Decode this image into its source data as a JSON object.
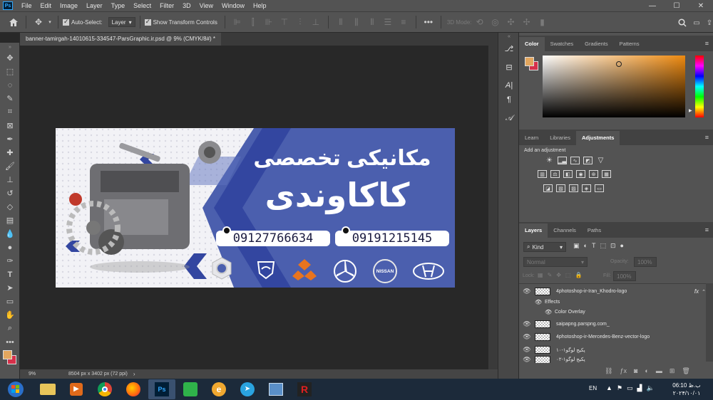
{
  "app": {
    "name": "Photoshop",
    "logo": "Ps"
  },
  "menu": [
    "File",
    "Edit",
    "Image",
    "Layer",
    "Type",
    "Select",
    "Filter",
    "3D",
    "View",
    "Window",
    "Help"
  ],
  "window_controls": {
    "minimize": "—",
    "maximize": "☐",
    "close": "✕"
  },
  "options_bar": {
    "auto_select_label": "Auto-Select:",
    "auto_select_value": "Layer",
    "show_transform_label": "Show Transform Controls",
    "mode_3d_label": "3D Mode:",
    "more_icon": "•••"
  },
  "document": {
    "tab_title": "banner-tamirgah-14010615-334547-ParsGraphic.ir.psd @ 9% (CMYK/8#) *",
    "zoom": "9%",
    "doc_size": "8504 px x 3402 px (72 ppi)"
  },
  "banner": {
    "title_line1": "مکانیکی تخصصی",
    "title_line2": "کاکاوندی",
    "phone1": "09127766634",
    "phone2": "09191215145",
    "brand_nissan": "NISSAN",
    "colors": {
      "blue": "#4b5fae",
      "dark_blue": "#3346a0",
      "light_blue": "#6b80c8"
    }
  },
  "color_panel": {
    "tabs": [
      "Color",
      "Swatches",
      "Gradients",
      "Patterns"
    ],
    "active_tab": "Color",
    "foreground": "#e3a65e",
    "background": "#d6304a"
  },
  "adjustments_panel": {
    "tabs": [
      "Learn",
      "Libraries",
      "Adjustments"
    ],
    "active_tab": "Adjustments",
    "add_label": "Add an adjustment"
  },
  "layers_panel": {
    "tabs": [
      "Layers",
      "Channels",
      "Paths"
    ],
    "active_tab": "Layers",
    "filter_kind": "Kind",
    "blend_mode": "Normal",
    "opacity_label": "Opacity:",
    "opacity_value": "100%",
    "lock_label": "Lock:",
    "fill_label": "Fill:",
    "fill_value": "100%",
    "fx_label": "fx",
    "effects_label": "Effects",
    "color_overlay_label": "Color Overlay",
    "layers": [
      "4photoshop-ir-Iran_Khodro-logo",
      "saipapng.parspng.com_",
      "4photoshop-ir-Mercedes-Benz-vector-logo",
      "پکیج لوگو۱-۱۰",
      "پکیج لوگو۱-۰۲"
    ]
  },
  "taskbar": {
    "language": "EN",
    "time": "06:10 ب.ظ",
    "date": "۲۰۲۴/۱۰/۰۱"
  }
}
